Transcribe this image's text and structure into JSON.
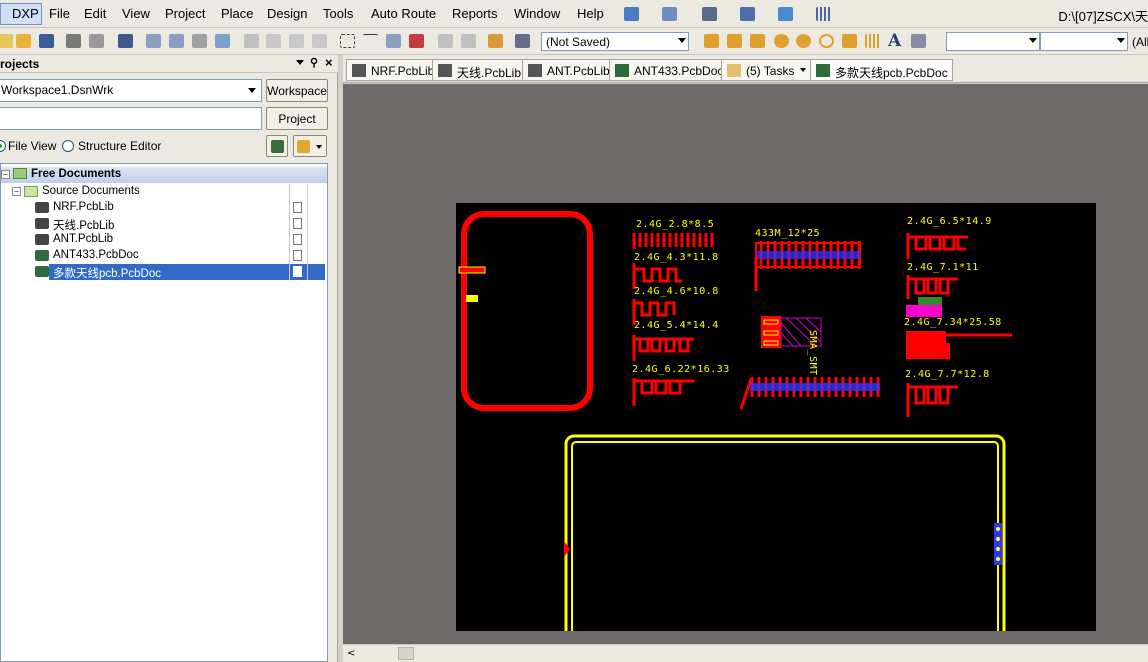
{
  "menubar": {
    "dxp": "DXP",
    "items": [
      "File",
      "Edit",
      "View",
      "Project",
      "Place",
      "Design",
      "Tools",
      "Auto Route",
      "Reports",
      "Window",
      "Help"
    ],
    "path": "D:\\[07]ZSCX\\天"
  },
  "toolbar": {
    "save_state": "(Not Saved)",
    "filter_right": "(All"
  },
  "panel": {
    "title": "Projects",
    "workspace_value": "Workspace1.DsnWrk",
    "workspace_button": "Workspace",
    "project_value": "",
    "project_button": "Project",
    "view_file": "File View",
    "view_structure": "Structure Editor",
    "tree": {
      "group": "Free Documents",
      "folder": "Source Documents",
      "files": [
        {
          "name": "NRF.PcbLib",
          "type": "lib"
        },
        {
          "name": "天线.PcbLib",
          "type": "lib"
        },
        {
          "name": "ANT.PcbLib",
          "type": "lib"
        },
        {
          "name": "ANT433.PcbDoc",
          "type": "pcb"
        },
        {
          "name": "多款天线pcb.PcbDoc",
          "type": "pcb",
          "selected": true
        }
      ]
    }
  },
  "tabs": [
    {
      "label": "NRF.PcbLib",
      "type": "lib"
    },
    {
      "label": "天线.PcbLib",
      "type": "lib"
    },
    {
      "label": "ANT.PcbLib",
      "type": "lib"
    },
    {
      "label": "ANT433.PcbDoc",
      "type": "pcb"
    },
    {
      "label": "(5) Tasks",
      "type": "tasks"
    },
    {
      "label": "多款天线pcb.PcbDoc",
      "type": "pcb"
    }
  ],
  "pcb_labels": {
    "a1": "2.4G_2.8*8.5",
    "a2": "2.4G_4.3*11.8",
    "a3": "2.4G_4.6*10.8",
    "a4": "2.4G_5.4*14.4",
    "a5": "2.4G_6.22*16.33",
    "b1": "433M_12*25",
    "b2": "SMA_SMT",
    "c1": "2.4G_6.5*14.9",
    "c2": "2.4G_7.1*11",
    "c3": "2.4G_7.34*25.58",
    "c4": "2.4G_7.7*12.8"
  },
  "colors": {
    "board": "#000000",
    "top_layer": "#ff0000",
    "silk": "#ffff00",
    "via": "#3333ff",
    "bg": "#6e6a6a"
  }
}
